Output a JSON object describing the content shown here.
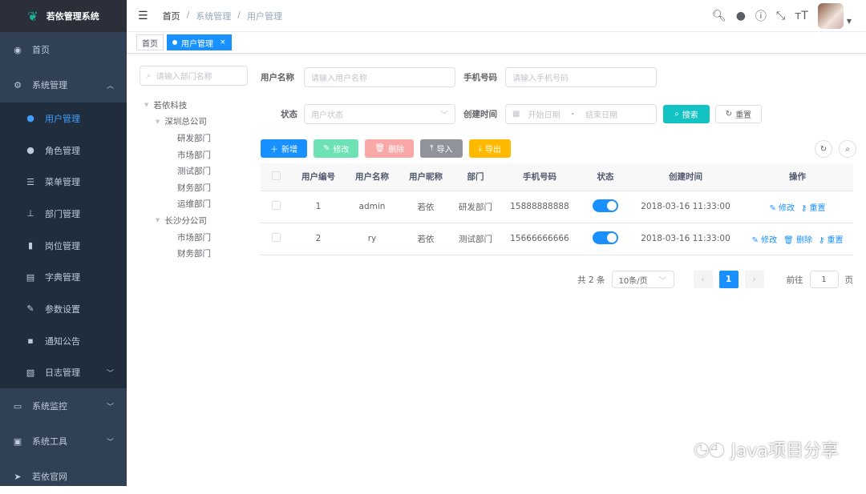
{
  "app": {
    "title": "若依管理系统"
  },
  "sidebar": {
    "items": [
      {
        "label": "首页",
        "icon": "dashboard-icon"
      },
      {
        "label": "系统管理",
        "icon": "gear-icon",
        "children": [
          {
            "label": "用户管理",
            "icon": "user-icon",
            "active": true
          },
          {
            "label": "角色管理",
            "icon": "peoples-icon"
          },
          {
            "label": "菜单管理",
            "icon": "tree-table-icon"
          },
          {
            "label": "部门管理",
            "icon": "tree-icon"
          },
          {
            "label": "岗位管理",
            "icon": "post-icon"
          },
          {
            "label": "字典管理",
            "icon": "dict-icon"
          },
          {
            "label": "参数设置",
            "icon": "edit-icon"
          },
          {
            "label": "通知公告",
            "icon": "message-icon"
          },
          {
            "label": "日志管理",
            "icon": "log-icon"
          }
        ]
      },
      {
        "label": "系统监控",
        "icon": "monitor-icon"
      },
      {
        "label": "系统工具",
        "icon": "tool-icon"
      },
      {
        "label": "若依官网",
        "icon": "guide-icon"
      }
    ]
  },
  "breadcrumb": [
    "首页",
    "系统管理",
    "用户管理"
  ],
  "tags": [
    {
      "label": "首页"
    },
    {
      "label": "用户管理",
      "close": "×"
    }
  ],
  "tree": {
    "placeholder": "请输入部门名称",
    "nodes": [
      {
        "label": "若依科技",
        "level": 0
      },
      {
        "label": "深圳总公司",
        "level": 1
      },
      {
        "label": "研发部门",
        "level": 2
      },
      {
        "label": "市场部门",
        "level": 2
      },
      {
        "label": "测试部门",
        "level": 2
      },
      {
        "label": "财务部门",
        "level": 2
      },
      {
        "label": "运维部门",
        "level": 2
      },
      {
        "label": "长沙分公司",
        "level": 1
      },
      {
        "label": "市场部门",
        "level": 2
      },
      {
        "label": "财务部门",
        "level": 2
      }
    ]
  },
  "form": {
    "username_label": "用户名称",
    "username_ph": "请输入用户名称",
    "phone_label": "手机号码",
    "phone_ph": "请输入手机号码",
    "status_label": "状态",
    "status_ph": "用户状态",
    "time_label": "创建时间",
    "start_ph": "开始日期",
    "sep": "-",
    "end_ph": "结束日期",
    "search": "搜索",
    "reset": "重置"
  },
  "toolbar": {
    "add": "新增",
    "edit": "修改",
    "delete": "删除",
    "import": "导入",
    "export": "导出"
  },
  "table": {
    "headers": [
      "用户编号",
      "用户名称",
      "用户昵称",
      "部门",
      "手机号码",
      "状态",
      "创建时间",
      "操作"
    ],
    "rows": [
      {
        "id": "1",
        "name": "admin",
        "nick": "若依",
        "dept": "研发部门",
        "phone": "15888888888",
        "status": true,
        "time": "2018-03-16 11:33:00",
        "ops": [
          "修改",
          "重置"
        ]
      },
      {
        "id": "2",
        "name": "ry",
        "nick": "若依",
        "dept": "测试部门",
        "phone": "15666666666",
        "status": true,
        "time": "2018-03-16 11:33:00",
        "ops": [
          "修改",
          "删除",
          "重置"
        ]
      }
    ]
  },
  "pager": {
    "total": "共 2 条",
    "size": "10条/页",
    "page": "1",
    "goto": "前往",
    "goto_val": "1",
    "unit": "页"
  },
  "watermark": "Java项目分享"
}
